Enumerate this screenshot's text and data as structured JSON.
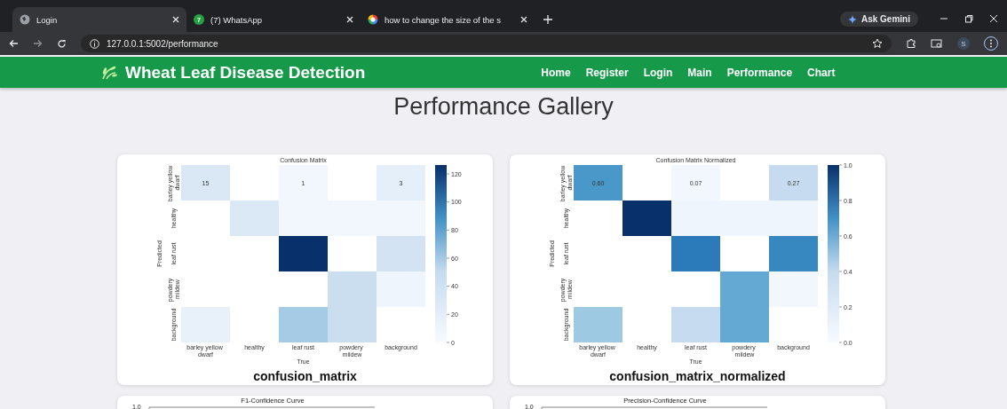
{
  "browser": {
    "tabs": [
      {
        "title": "Login",
        "selected": true
      },
      {
        "title": "(7) WhatsApp",
        "badge": "7",
        "selected": false
      },
      {
        "title": "how to change the size of the s",
        "selected": false
      }
    ],
    "address": "127.0.0.1:5002/performance",
    "ask_button": "Ask Gemini",
    "profile": "S"
  },
  "navbar": {
    "brand": "Wheat Leaf Disease Detection",
    "links": [
      "Home",
      "Register",
      "Login",
      "Main",
      "Performance",
      "Chart"
    ]
  },
  "page_title": "Performance Gallery",
  "matrices": [
    {
      "plot_title": "Confusion Matrix",
      "caption": "confusion_matrix",
      "ylabel": "Predicted",
      "xlabel": "True",
      "row_labels": [
        "barley yellow dwarf",
        "healthy",
        "leaf rust",
        "powdery mildew",
        "background"
      ],
      "column_labels": [
        "barley yellow dwarf",
        "healthy",
        "leaf rust",
        "powdery mildew",
        "background"
      ],
      "colorbar_ticks": [
        "120",
        "100",
        "80",
        "60",
        "40",
        "20",
        "0"
      ],
      "rows": [
        {
          "cells": [
            {
              "color": "#dae8f5",
              "value": "15"
            },
            null,
            {
              "color": "#f2f7fd",
              "value": "1"
            },
            null,
            {
              "color": "#e4eff9",
              "value": "3"
            }
          ]
        },
        {
          "cells": [
            null,
            {
              "color": "#dbe9f6"
            },
            {
              "color": "#f2f7fd"
            },
            {
              "color": "#f2f7fd"
            },
            {
              "color": "#f2f7fd"
            }
          ]
        },
        {
          "cells": [
            null,
            null,
            {
              "color": "#08306b"
            },
            null,
            {
              "color": "#d3e3f3"
            }
          ]
        },
        {
          "cells": [
            null,
            null,
            null,
            {
              "color": "#cbdef0"
            },
            {
              "color": "#eff5fc"
            }
          ]
        },
        {
          "cells": [
            {
              "color": "#e8f1fa"
            },
            null,
            {
              "color": "#a5cce4"
            },
            {
              "color": "#cbdef0"
            },
            null
          ]
        }
      ]
    },
    {
      "plot_title": "Confusion Matrix Normalized",
      "caption": "confusion_matrix_normalized",
      "ylabel": "Predicted",
      "xlabel": "True",
      "row_labels": [
        "barley yellow dwarf",
        "healthy",
        "leaf rust",
        "powdery mildew",
        "background"
      ],
      "column_labels": [
        "barley yellow dwarf",
        "healthy",
        "leaf rust",
        "powdery mildew",
        "background"
      ],
      "colorbar_ticks": [
        "1.0",
        "0.8",
        "0.6",
        "0.4",
        "0.2",
        "0.0"
      ],
      "rows": [
        {
          "cells": [
            {
              "color": "#4a98c9",
              "value": "0.60"
            },
            null,
            {
              "color": "#f2f7fd",
              "value": "0.07"
            },
            null,
            {
              "color": "#c6dbef",
              "value": "0.27"
            }
          ]
        },
        {
          "cells": [
            null,
            {
              "color": "#08306b"
            },
            {
              "color": "#eef5fc"
            },
            {
              "color": "#eef5fc"
            },
            {
              "color": "#eef5fc"
            }
          ]
        },
        {
          "cells": [
            null,
            null,
            {
              "color": "#2b7bba"
            },
            null,
            {
              "color": "#3787c0"
            }
          ]
        },
        {
          "cells": [
            null,
            null,
            null,
            {
              "color": "#64a9d3"
            },
            {
              "color": "#f2f7fd"
            }
          ]
        },
        {
          "cells": [
            {
              "color": "#9dc9e2"
            },
            null,
            {
              "color": "#c6dbef"
            },
            {
              "color": "#64a9d3"
            },
            null
          ]
        }
      ]
    }
  ],
  "curves": [
    {
      "title": "F1-Confidence Curve",
      "top_tick": "1.0"
    },
    {
      "title": "Precision-Confidence Curve",
      "top_tick": "1.0"
    }
  ]
}
